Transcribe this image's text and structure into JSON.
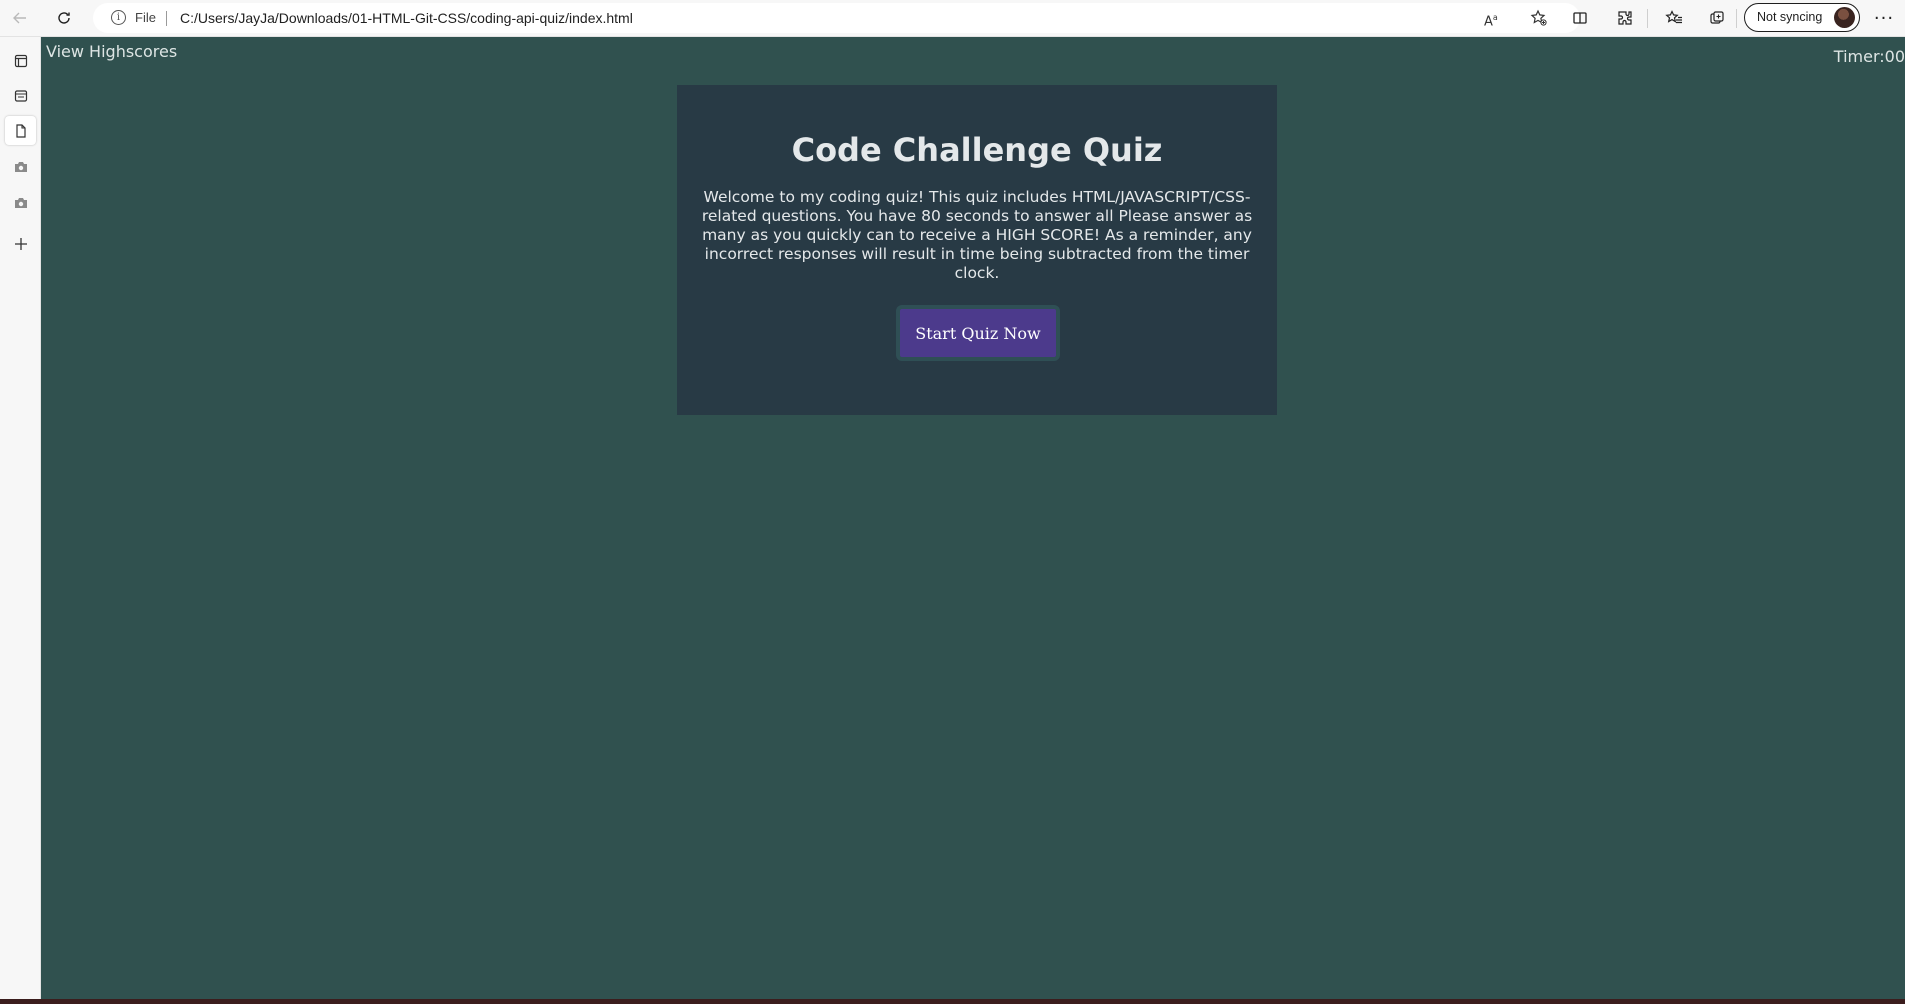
{
  "browser": {
    "back_icon": "back-arrow-icon",
    "refresh_icon": "refresh-icon",
    "address": {
      "scheme_label": "File",
      "url": "C:/Users/JayJa/Downloads/01-HTML-Git-CSS/coding-api-quiz/index.html",
      "read_aloud_glyph": "Aᵃ"
    },
    "profile": {
      "sync_label": "Not syncing"
    },
    "more_glyph": "···"
  },
  "page": {
    "background_color": "#30514f",
    "highscores_link": "View Highscores",
    "timer_label": "Timer:",
    "timer_value": "00",
    "quiz": {
      "title": "Code Challenge Quiz",
      "description": "Welcome to my coding quiz! This quiz includes HTML/JAVASCRIPT/CSS-related questions. You have 80 seconds to answer all Please answer as many as you quickly can to receive a HIGH SCORE! As a reminder, any incorrect responses will result in time being subtracted from the timer clock.",
      "start_button": "Start Quiz Now",
      "card_color": "#283a45",
      "button_color": "#4c3a8c"
    }
  }
}
